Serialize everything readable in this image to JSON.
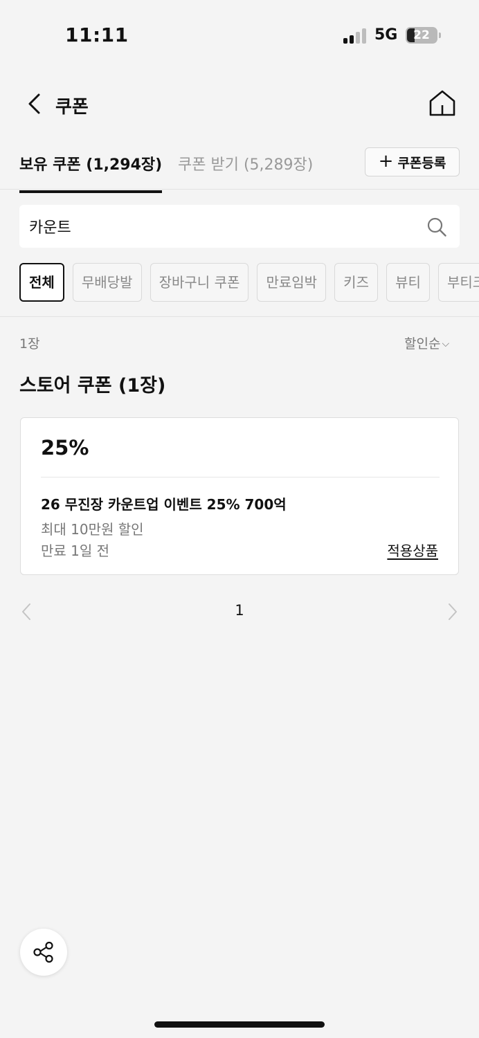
{
  "status_bar": {
    "time": "11:11",
    "network": "5G",
    "battery": "22"
  },
  "header": {
    "title": "쿠폰"
  },
  "tabs": {
    "owned": "보유 쿠폰 (1,294장)",
    "receive": "쿠폰 받기 (5,289장)",
    "register_label": "쿠폰등록",
    "register_icon": "+"
  },
  "search": {
    "value": "카운트"
  },
  "filters": [
    "전체",
    "무배당발",
    "장바구니 쿠폰",
    "만료임박",
    "키즈",
    "뷰티",
    "부티크"
  ],
  "list": {
    "count": "1장",
    "sort_label": "할인순",
    "sort_icon": "⌵",
    "section_title": "스토어 쿠폰 (1장)"
  },
  "coupon": {
    "discount": "25%",
    "name": "26 무진장 카운트업 이벤트 25% 700억",
    "max_discount": "최대 10만원 할인",
    "expiry": "만료 1일 전",
    "products_link": "적용상품"
  },
  "pagination": {
    "current": "1"
  }
}
